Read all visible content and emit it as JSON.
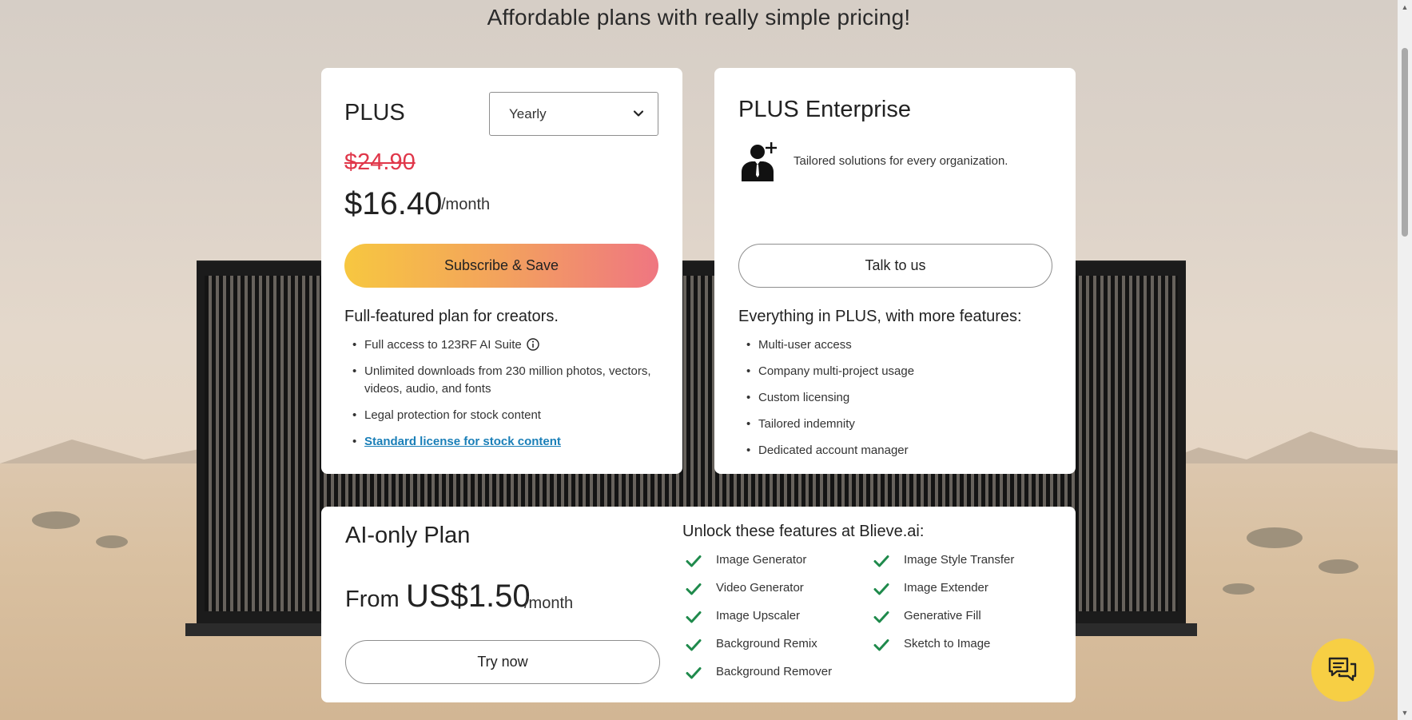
{
  "page": {
    "headline": "Affordable plans with really simple pricing!"
  },
  "plus": {
    "title": "PLUS",
    "billing_select": {
      "value": "Yearly",
      "icon": "chevron-down-icon"
    },
    "old_price": "$24.90",
    "price": "$16.40",
    "price_unit": "/month",
    "cta": "Subscribe & Save",
    "features_heading": "Full-featured plan for creators.",
    "features": [
      "Full access to 123RF AI Suite",
      "Unlimited downloads from 230 million photos, vectors, videos, audio, and fonts",
      "Legal protection for stock content"
    ],
    "license_link": "Standard license for stock content",
    "info_icon": "info-icon",
    "colors": {
      "old_price": "#e0374a",
      "gradient_start": "#f7c740",
      "gradient_end": "#ef7681",
      "link": "#1a7fb8"
    }
  },
  "enterprise": {
    "title": "PLUS Enterprise",
    "icon": "add-user-icon",
    "description": "Tailored solutions for every organization.",
    "cta": "Talk to us",
    "features_heading": "Everything in PLUS, with more features:",
    "features": [
      "Multi-user access",
      "Company multi-project usage",
      "Custom licensing",
      "Tailored indemnity",
      "Dedicated account manager"
    ]
  },
  "ai_plan": {
    "title": "AI-only Plan",
    "price_prefix": "From",
    "price": "US$1.50",
    "price_unit": "/month",
    "cta": "Try now",
    "features_heading": "Unlock these features at Blieve.ai:",
    "features_left": [
      "Image Generator",
      "Video Generator",
      "Image Upscaler",
      "Background Remix",
      "Background Remover"
    ],
    "features_right": [
      "Image Style Transfer",
      "Image Extender",
      "Generative Fill",
      "Sketch to Image"
    ],
    "check_icon": "check-icon",
    "colors": {
      "check": "#1f8a4c"
    }
  },
  "chat": {
    "icon": "chat-bubbles-icon",
    "color": "#f7cf44"
  }
}
